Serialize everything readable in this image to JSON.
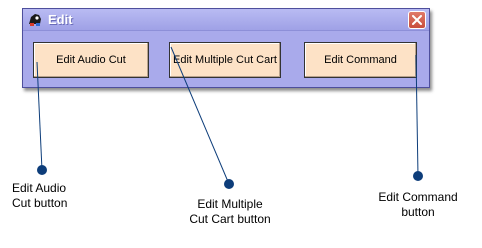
{
  "window": {
    "title": "Edit",
    "icon": "app-icon",
    "close_icon": "close-icon"
  },
  "buttons": {
    "edit_audio_cut": "Edit Audio Cut",
    "edit_multiple_cut_cart": "Edit Multiple Cut Cart",
    "edit_command": "Edit Command"
  },
  "callouts": {
    "audio": {
      "line1": "Edit Audio",
      "line2": "Cut button"
    },
    "multi": {
      "line1": "Edit Multiple",
      "line2": "Cut Cart button"
    },
    "command": {
      "line1": "Edit Command",
      "line2": "button"
    }
  },
  "colors": {
    "window_bg": "#a9aaeb",
    "button_bg": "#fde2c6",
    "callout": "#0d3d7a",
    "close_button": "#c94e3c"
  }
}
